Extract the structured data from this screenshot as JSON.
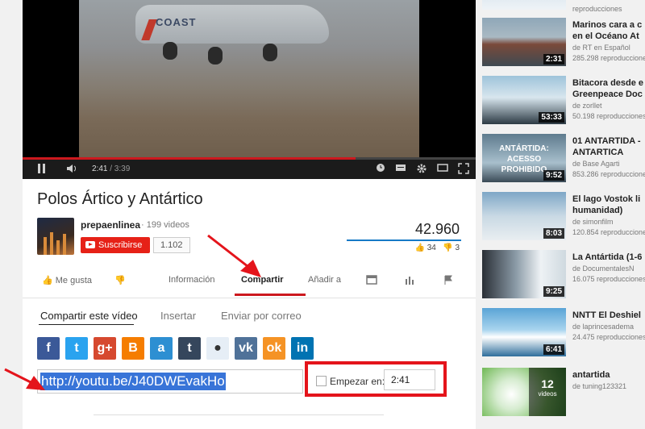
{
  "player": {
    "current_time": "2:41",
    "duration": "/ 3:39",
    "progress": 0.735,
    "video_text": "COAST"
  },
  "video": {
    "title": "Polos Ártico y Antártico",
    "channel": "prepaenlinea",
    "video_count": "· 199 videos",
    "subscribe_label": "Suscribirse",
    "subscriber_count": "1.102",
    "views": "42.960",
    "likes": "34",
    "dislikes": "3"
  },
  "actions": {
    "like": "Me gusta",
    "info": "Información",
    "share": "Compartir",
    "add_to": "Añadir a"
  },
  "share": {
    "tabs": [
      "Compartir este vídeo",
      "Insertar",
      "Enviar por correo"
    ],
    "link": "http://youtu.be/J40DWEvakHo",
    "start_label": "Empezar en:",
    "start_value": "2:41",
    "socials": [
      {
        "name": "facebook",
        "glyph": "f",
        "color": "#3b5998"
      },
      {
        "name": "twitter",
        "glyph": "t",
        "color": "#2aa3ef"
      },
      {
        "name": "google-plus",
        "glyph": "g+",
        "color": "#d6492f"
      },
      {
        "name": "blogger",
        "glyph": "B",
        "color": "#f57d00"
      },
      {
        "name": "ameba",
        "glyph": "a",
        "color": "#2d8fd2"
      },
      {
        "name": "tumblr",
        "glyph": "t",
        "color": "#35465c"
      },
      {
        "name": "reddit",
        "glyph": "●",
        "color": "#e6eef6"
      },
      {
        "name": "vk",
        "glyph": "vk",
        "color": "#507299"
      },
      {
        "name": "odnoklassniki",
        "glyph": "ok",
        "color": "#f59325"
      },
      {
        "name": "linkedin",
        "glyph": "in",
        "color": "#0073b2"
      }
    ]
  },
  "related": [
    {
      "title": "",
      "by": "",
      "views": "",
      "duration": ""
    },
    {
      "title": "Marinos cara a c",
      "title2": "en el Océano At",
      "by": "de RT en Español",
      "views": "285.298 reproducciones",
      "duration": "2:31"
    },
    {
      "title": "Bitacora desde e",
      "title2": "Greenpeace Doc",
      "by": "de zorllet",
      "views": "50.198 reproducciones",
      "duration": "53:33"
    },
    {
      "title": "01 ANTARTIDA - ",
      "title2": "ANTARTICA",
      "by": "de Base Agarti",
      "views": "853.286 reproducciones",
      "duration": "9:52",
      "overlay": "ANTÁRTIDA: ACESSO PROHIBIDO"
    },
    {
      "title": "El lago Vostok li",
      "title2": "humanidad)",
      "by": "de simonfilm",
      "views": "120.854 reproducciones",
      "duration": "8:03"
    },
    {
      "title": "La Antártida (1-6",
      "title2": "",
      "by": "de DocumentalesN",
      "views": "16.075 reproducciones",
      "duration": "9:25"
    },
    {
      "title": "NNTT El Deshiel",
      "title2": "",
      "by": "de laprincesadema",
      "views": "24.475 reproducciones",
      "duration": "6:41"
    },
    {
      "title": "antartida",
      "title2": "",
      "by": "de tuning123321",
      "views": "",
      "duration": "",
      "playlist_count": "12",
      "playlist_label": "videos"
    }
  ],
  "colors": {
    "accent_red": "#cc181e",
    "link_blue": "#167ac6",
    "highlight_box": "#e4141b"
  }
}
